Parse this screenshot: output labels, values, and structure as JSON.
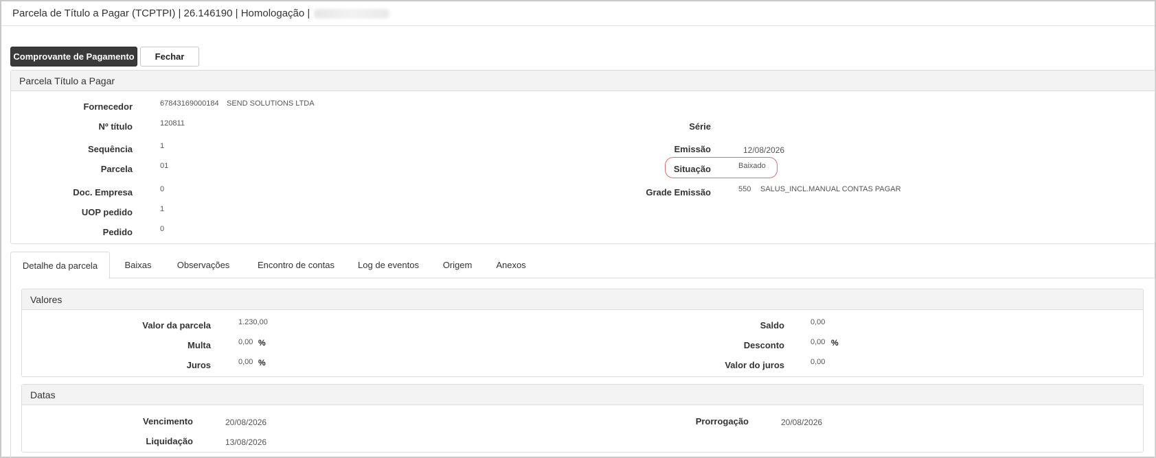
{
  "window": {
    "title": "Parcela de Título a Pagar (TCPTPI) | 26.146190 | Homologação |"
  },
  "toolbar": {
    "primary_label": "Comprovante de Pagamento",
    "close_label": "Fechar"
  },
  "header_panel": {
    "title": "Parcela Título a Pagar",
    "fornecedor_label": "Fornecedor",
    "fornecedor_code": "67843169000184",
    "fornecedor_name": "SEND SOLUTIONS LTDA",
    "titulo_label": "Nº título",
    "titulo_value": "120811",
    "sequencia_label": "Sequência",
    "sequencia_value": "1",
    "parcela_label": "Parcela",
    "parcela_value": "01",
    "doc_empresa_label": "Doc. Empresa",
    "doc_empresa_value": "0",
    "uop_label": "UOP pedido",
    "uop_value": "1",
    "pedido_label": "Pedido",
    "pedido_value": "0",
    "serie_label": "Série",
    "serie_value": "",
    "emissao_label": "Emissão",
    "emissao_value": "12/08/2026",
    "situacao_label": "Situação",
    "situacao_value": "Baixado",
    "grade_label": "Grade Emissão",
    "grade_code": "550",
    "grade_name": "SALUS_INCL.MANUAL CONTAS PAGAR"
  },
  "tabs": [
    {
      "label": "Detalhe da parcela",
      "active": true
    },
    {
      "label": "Baixas"
    },
    {
      "label": "Observações"
    },
    {
      "label": "Encontro de contas"
    },
    {
      "label": "Log de eventos"
    },
    {
      "label": "Origem"
    },
    {
      "label": "Anexos"
    }
  ],
  "valores": {
    "title": "Valores",
    "valor_parcela_label": "Valor da parcela",
    "valor_parcela_value": "1.230,00",
    "multa_label": "Multa",
    "multa_value": "0,00",
    "juros_label": "Juros",
    "juros_value": "0,00",
    "saldo_label": "Saldo",
    "saldo_value": "0,00",
    "desconto_label": "Desconto",
    "desconto_value": "0,00",
    "valor_juros_label": "Valor do juros",
    "valor_juros_value": "0,00",
    "percent": "%"
  },
  "datas": {
    "title": "Datas",
    "vencimento_label": "Vencimento",
    "vencimento_value": "20/08/2026",
    "liquidacao_label": "Liquidação",
    "liquidacao_value": "13/08/2026",
    "prorrogacao_label": "Prorrogação",
    "prorrogacao_value": "20/08/2026"
  },
  "colors": {
    "primary_button": "#3a3a3a",
    "highlight": "#e46b70"
  }
}
